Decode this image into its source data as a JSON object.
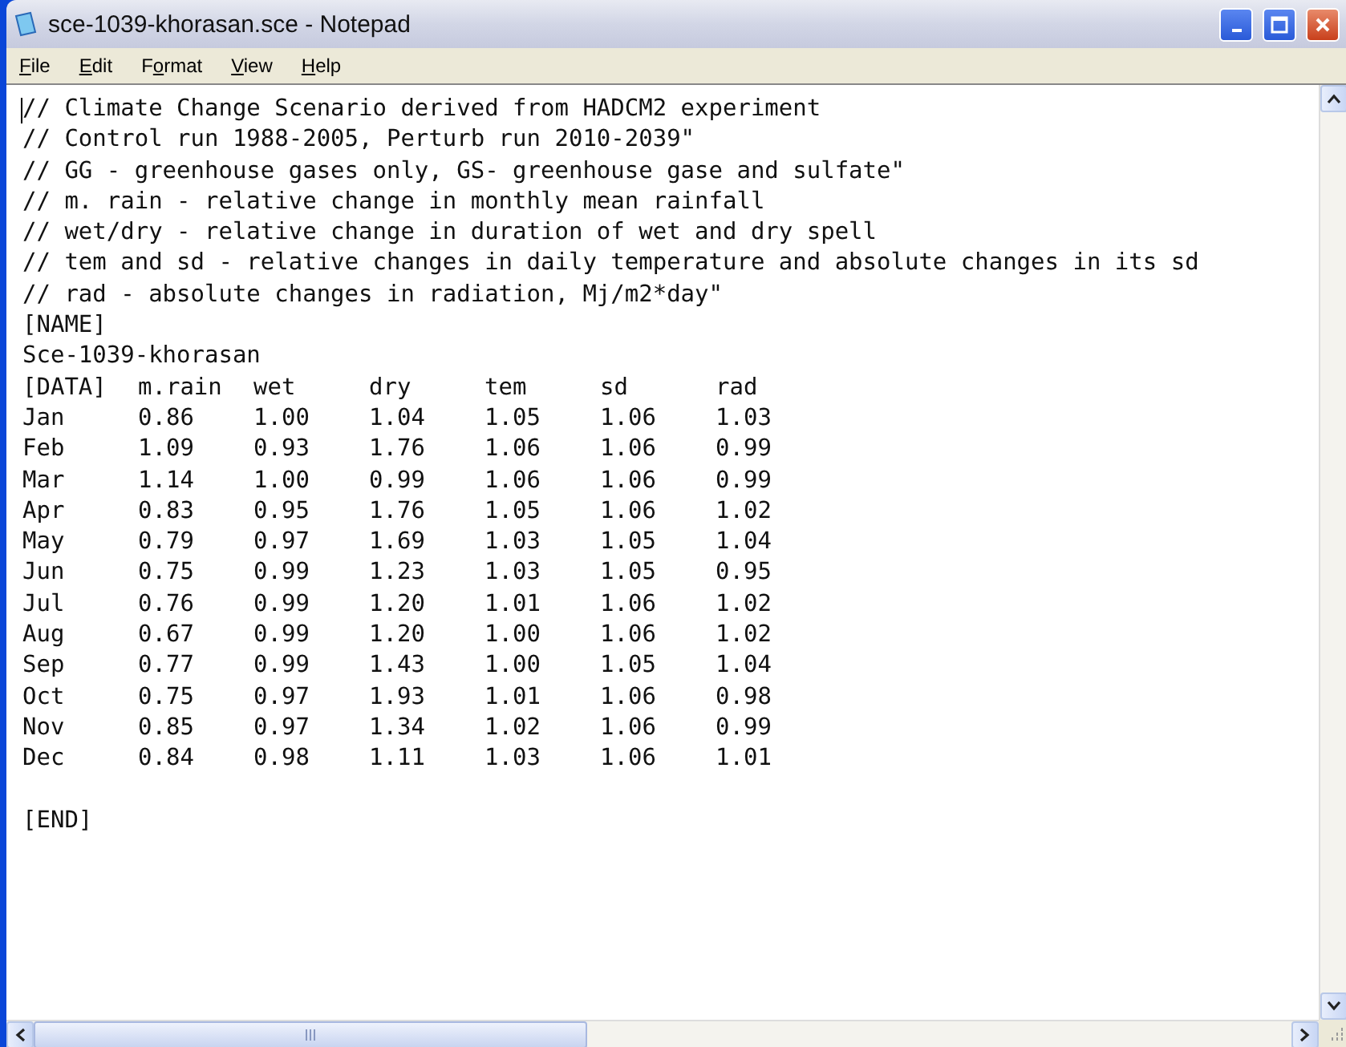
{
  "window": {
    "title": "sce-1039-khorasan.sce - Notepad"
  },
  "menu": [
    {
      "label_parts": [
        {
          "text": "F",
          "underlined": true
        },
        {
          "text": "ile",
          "underlined": false
        }
      ]
    },
    {
      "label_parts": [
        {
          "text": "E",
          "underlined": true
        },
        {
          "text": "dit",
          "underlined": false
        }
      ]
    },
    {
      "label_parts": [
        {
          "text": "F",
          "underlined": false
        },
        {
          "text": "o",
          "underlined": true
        },
        {
          "text": "rmat",
          "underlined": false
        }
      ]
    },
    {
      "label_parts": [
        {
          "text": "V",
          "underlined": true
        },
        {
          "text": "iew",
          "underlined": false
        }
      ]
    },
    {
      "label_parts": [
        {
          "text": "H",
          "underlined": true
        },
        {
          "text": "elp",
          "underlined": false
        }
      ]
    }
  ],
  "document": {
    "header_lines": [
      "// Climate Change Scenario derived from HADCM2 experiment",
      "// Control run 1988-2005, Perturb run 2010-2039\"",
      "// GG - greenhouse gases only, GS- greenhouse gase and sulfate\"",
      "// m. rain - relative change in monthly mean rainfall",
      "// wet/dry - relative change in duration of wet and dry spell",
      "// tem and sd - relative changes in daily temperature and absolute changes in its sd",
      "// rad - absolute changes in radiation, Mj/m2*day\"",
      "[NAME]",
      "Sce-1039-khorasan"
    ],
    "data_table": {
      "columns": [
        "[DATA]",
        "m.rain",
        "wet",
        "dry",
        "tem",
        "sd",
        "rad"
      ],
      "rows": [
        [
          "Jan",
          "0.86",
          "1.00",
          "1.04",
          "1.05",
          "1.06",
          "1.03"
        ],
        [
          "Feb",
          "1.09",
          "0.93",
          "1.76",
          "1.06",
          "1.06",
          "0.99"
        ],
        [
          "Mar",
          "1.14",
          "1.00",
          "0.99",
          "1.06",
          "1.06",
          "0.99"
        ],
        [
          "Apr",
          "0.83",
          "0.95",
          "1.76",
          "1.05",
          "1.06",
          "1.02"
        ],
        [
          "May",
          "0.79",
          "0.97",
          "1.69",
          "1.03",
          "1.05",
          "1.04"
        ],
        [
          "Jun",
          "0.75",
          "0.99",
          "1.23",
          "1.03",
          "1.05",
          "0.95"
        ],
        [
          "Jul",
          "0.76",
          "0.99",
          "1.20",
          "1.01",
          "1.06",
          "1.02"
        ],
        [
          "Aug",
          "0.67",
          "0.99",
          "1.20",
          "1.00",
          "1.06",
          "1.02"
        ],
        [
          "Sep",
          "0.77",
          "0.99",
          "1.43",
          "1.00",
          "1.05",
          "1.04"
        ],
        [
          "Oct",
          "0.75",
          "0.97",
          "1.93",
          "1.01",
          "1.06",
          "0.98"
        ],
        [
          "Nov",
          "0.85",
          "0.97",
          "1.34",
          "1.02",
          "1.06",
          "0.99"
        ],
        [
          "Dec",
          "0.84",
          "0.98",
          "1.11",
          "1.03",
          "1.06",
          "1.01"
        ]
      ]
    },
    "footer_lines": [
      "[END]"
    ]
  }
}
